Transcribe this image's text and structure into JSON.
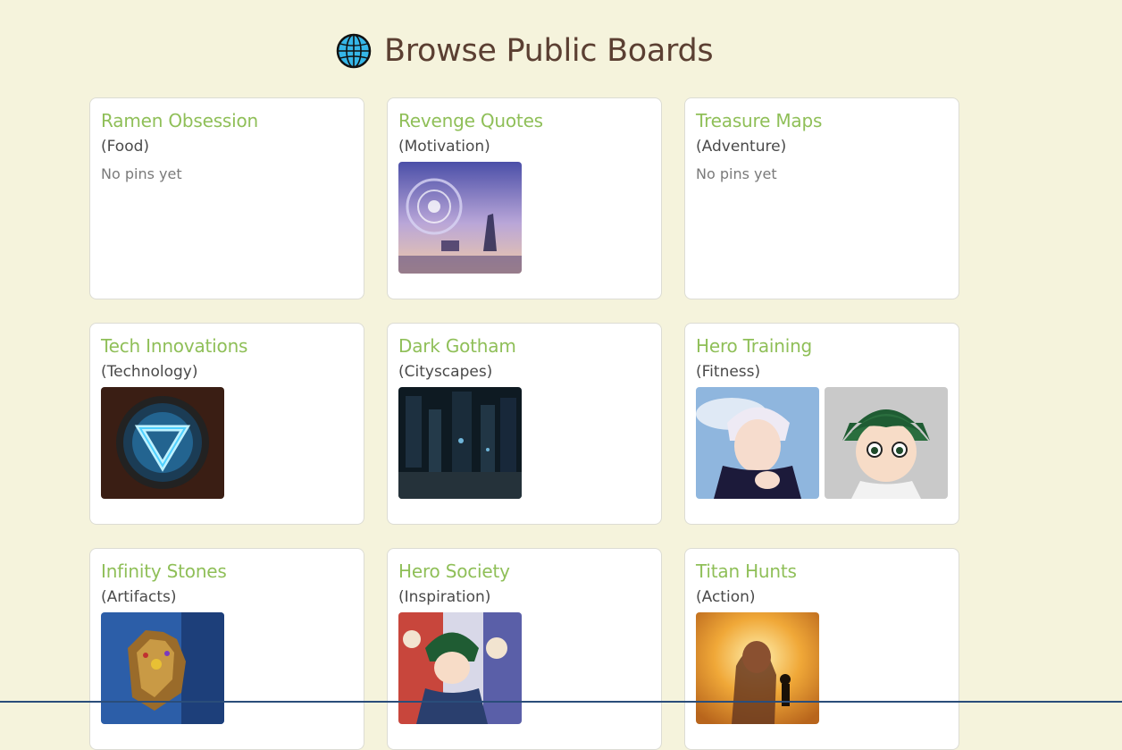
{
  "page": {
    "title": "Browse Public Boards",
    "title_icon": "globe-icon",
    "colors": {
      "background": "#f5f3dc",
      "title": "#5b3f32",
      "board_name": "#8fbf58",
      "card": "#ffffff"
    }
  },
  "boards": [
    {
      "name": "Ramen Obsession",
      "category": "(Food)",
      "empty_text": "No pins yet",
      "pins": []
    },
    {
      "name": "Revenge Quotes",
      "category": "(Motivation)",
      "pins": [
        "fantasy-sky-image"
      ]
    },
    {
      "name": "Treasure Maps",
      "category": "(Adventure)",
      "empty_text": "No pins yet",
      "pins": []
    },
    {
      "name": "Tech Innovations",
      "category": "(Technology)",
      "pins": [
        "arc-reactor-image"
      ]
    },
    {
      "name": "Dark Gotham",
      "category": "(Cityscapes)",
      "pins": [
        "dark-city-image"
      ]
    },
    {
      "name": "Hero Training",
      "category": "(Fitness)",
      "pins": [
        "white-hair-character-image",
        "green-hair-character-image"
      ]
    },
    {
      "name": "Infinity Stones",
      "category": "(Artifacts)",
      "pins": [
        "gauntlet-image"
      ]
    },
    {
      "name": "Hero Society",
      "category": "(Inspiration)",
      "pins": [
        "hero-group-image"
      ]
    },
    {
      "name": "Titan Hunts",
      "category": "(Action)",
      "pins": [
        "titan-fire-image"
      ]
    }
  ]
}
